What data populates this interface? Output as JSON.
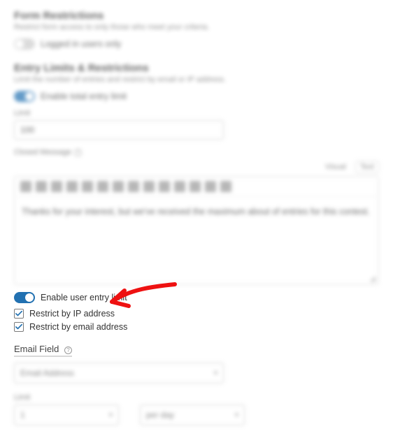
{
  "formRestrictions": {
    "heading": "Form Restrictions",
    "desc": "Restrict form access to only those who meet your criteria.",
    "loggedInLabel": "Logged in users only"
  },
  "entryLimits": {
    "heading": "Entry Limits & Restrictions",
    "desc": "Limit the number of entries and restrict by email or IP address.",
    "enableTotalLabel": "Enable total entry limit",
    "limitLabel": "Limit",
    "limitValue": "100",
    "closedMessageLabel": "Closed Message",
    "tabs": {
      "visual": "Visual",
      "text": "Text"
    },
    "closedMessageBody": "Thanks for your interest, but we've received the maximum about of entries for this contest."
  },
  "userEntryLimit": {
    "enableLabel": "Enable user entry limit",
    "restrictIpLabel": "Restrict by IP address",
    "restrictEmailLabel": "Restrict by email address"
  },
  "emailField": {
    "label": "Email Field",
    "selectValue": "Email Address"
  },
  "bottom": {
    "limitLabel": "Limit",
    "limitValue": "1",
    "perLabel": "per day"
  }
}
